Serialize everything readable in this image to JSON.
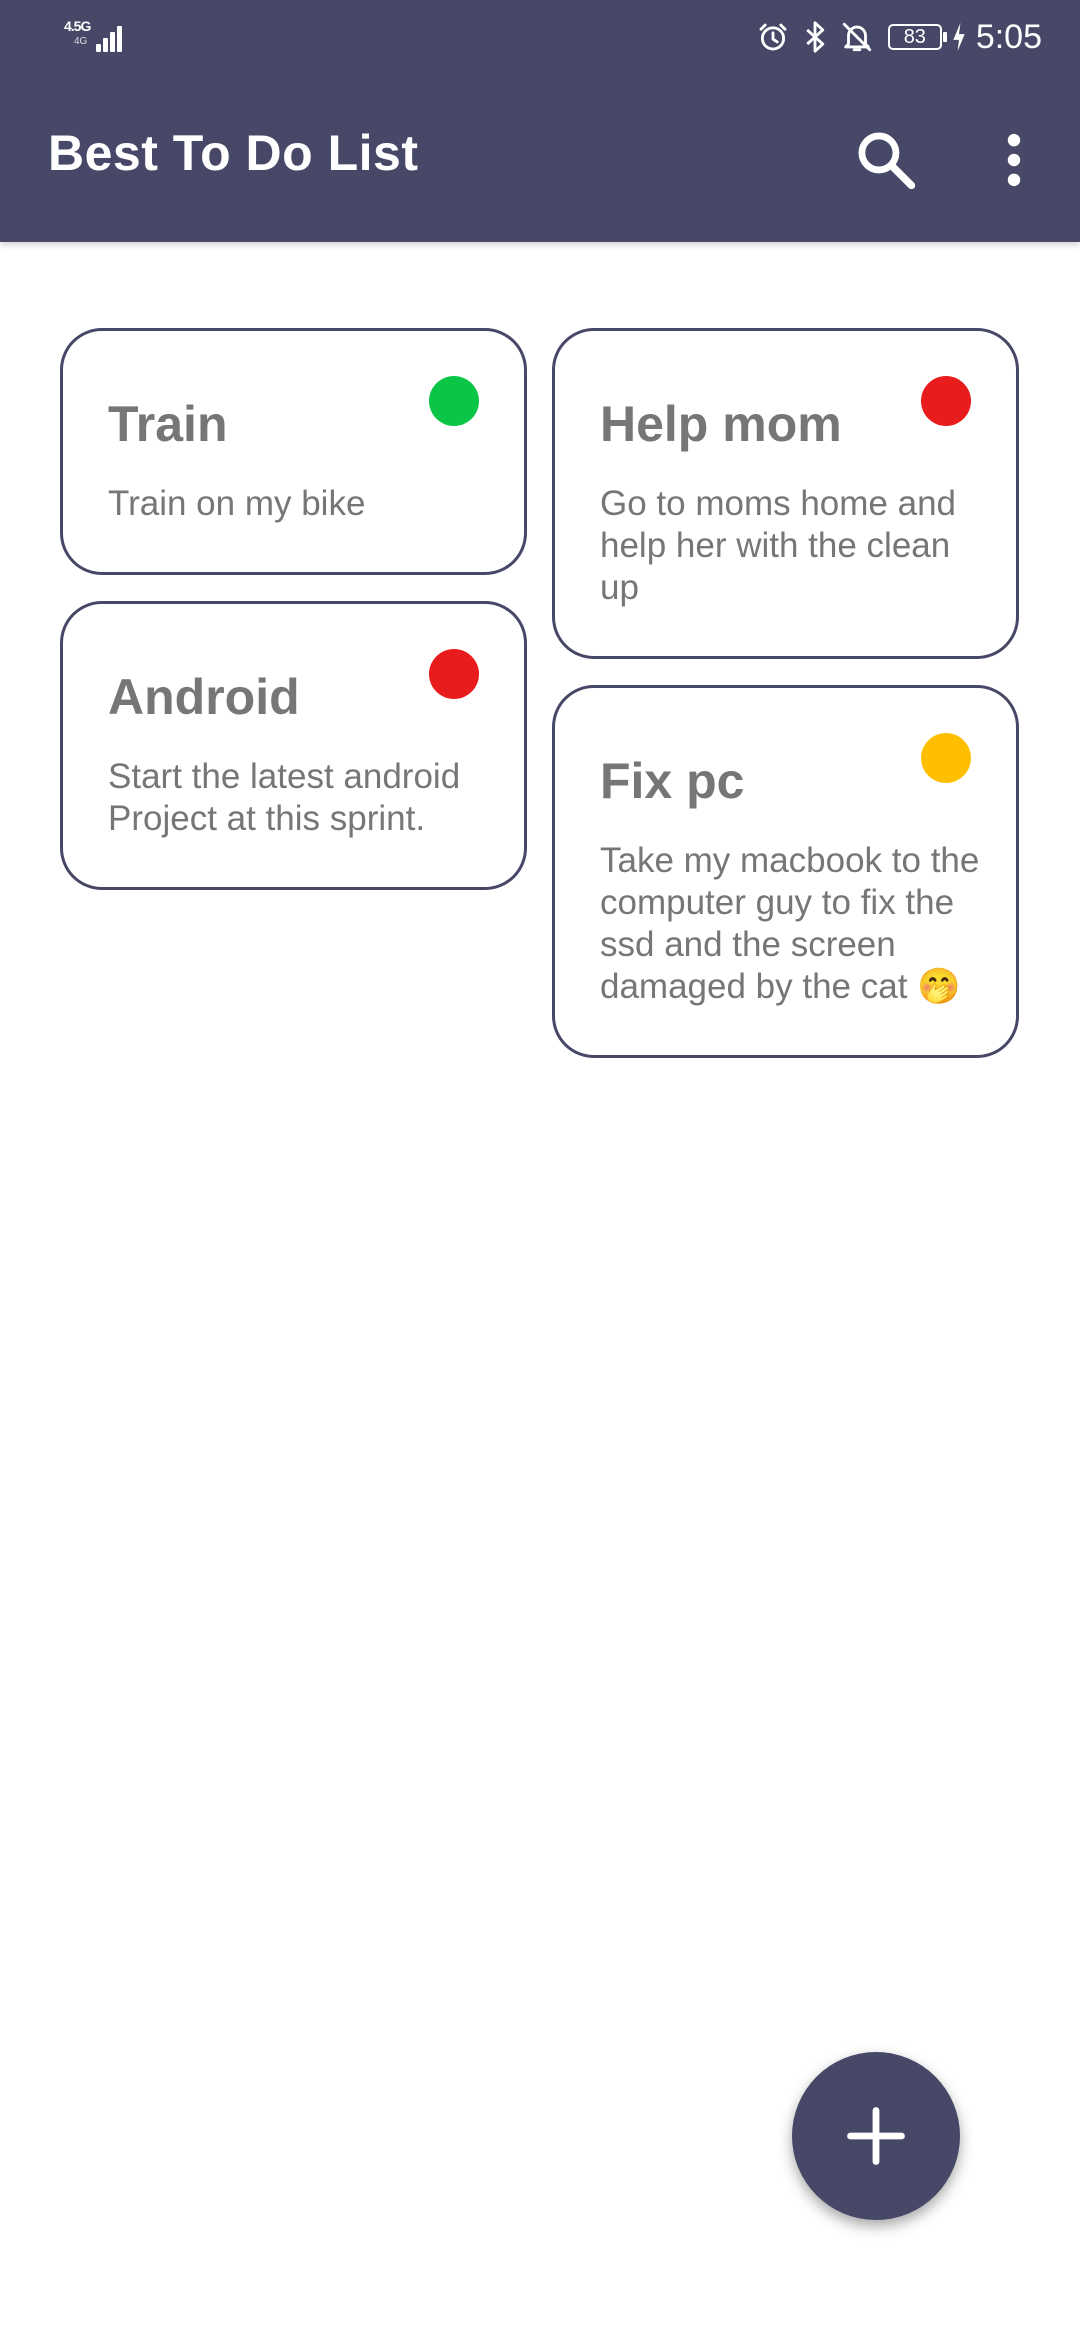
{
  "status_bar": {
    "network": "4.5G",
    "network_sub": "4G",
    "battery": "83",
    "time": "5:05",
    "icons": [
      "alarm-icon",
      "bluetooth-icon",
      "bell-off-icon",
      "charging-icon"
    ]
  },
  "app_bar": {
    "title": "Best To Do List",
    "background": "#474768",
    "actions": [
      "search-icon",
      "more-vert-icon"
    ]
  },
  "tasks": [
    {
      "title": "Train",
      "description": "Train on my bike",
      "priority_color": "#0BC546"
    },
    {
      "title": "Help mom",
      "description": "Go to moms home and help her with the clean up",
      "priority_color": "#E81C1C"
    },
    {
      "title": "Android",
      "description": "Start the latest android Project at this sprint.",
      "priority_color": "#E81C1C"
    },
    {
      "title": "Fix pc",
      "description": "Take my macbook to the computer guy to fix the ssd and the screen damaged by the cat 🤭",
      "priority_color": "#FFBF00"
    }
  ],
  "fab": {
    "icon": "plus-icon",
    "color": "#474768"
  }
}
